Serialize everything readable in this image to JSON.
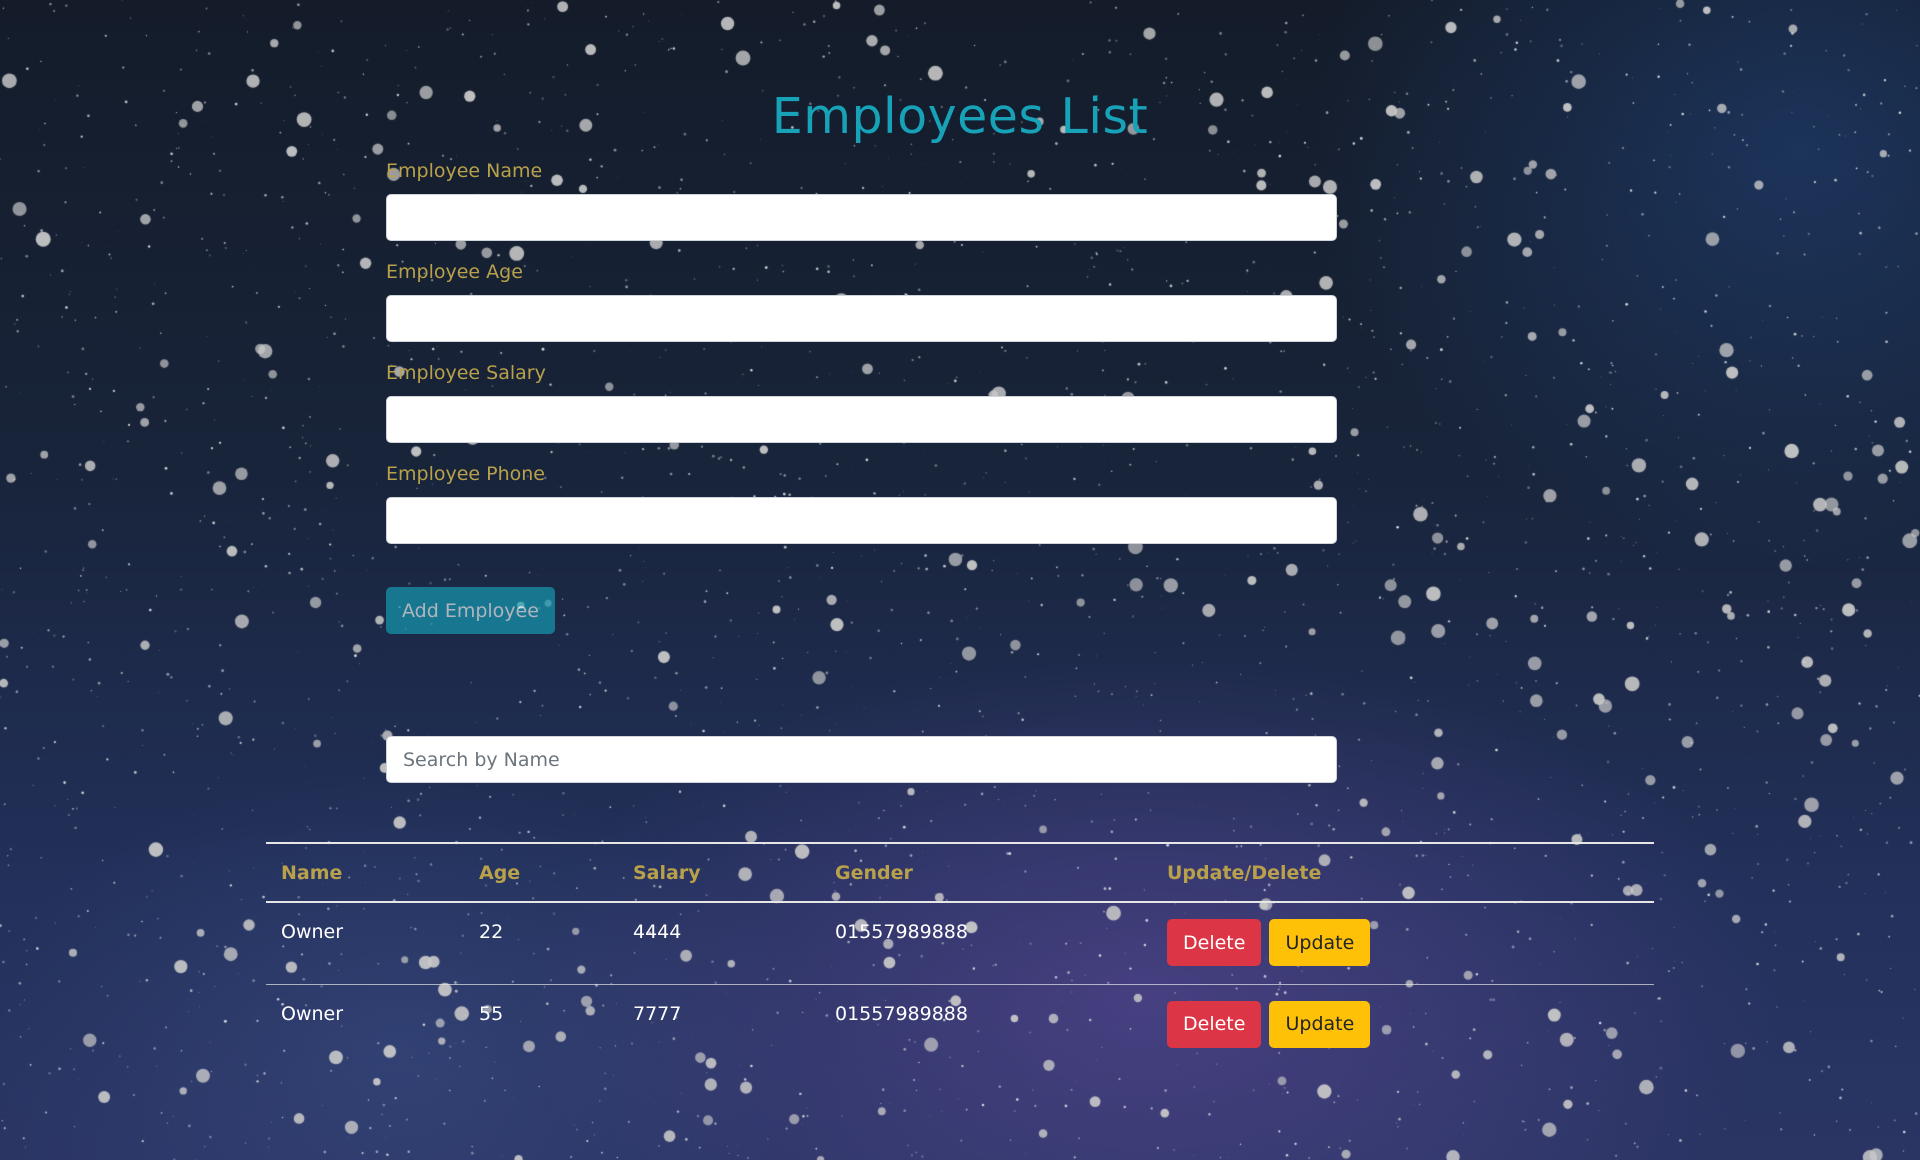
{
  "page": {
    "title": "Employees List"
  },
  "form": {
    "name_label": "Employee Name",
    "age_label": "Employee Age",
    "salary_label": "Employee Salary",
    "phone_label": "Employee Phone",
    "add_button_label": "Add Employee"
  },
  "search": {
    "placeholder": "Search by Name"
  },
  "table": {
    "headers": [
      "Name",
      "Age",
      "Salary",
      "Gender",
      "Update/Delete"
    ],
    "rows": [
      {
        "name": "Owner",
        "age": "22",
        "salary": "4444",
        "gender": "01557989888",
        "delete_label": "Delete",
        "update_label": "Update"
      },
      {
        "name": "Owner",
        "age": "55",
        "salary": "7777",
        "gender": "01557989888",
        "delete_label": "Delete",
        "update_label": "Update"
      }
    ]
  },
  "colors": {
    "title": "#17a2b8",
    "label": "#b8a14a",
    "delete": "#dc3545",
    "update": "#ffc107"
  }
}
